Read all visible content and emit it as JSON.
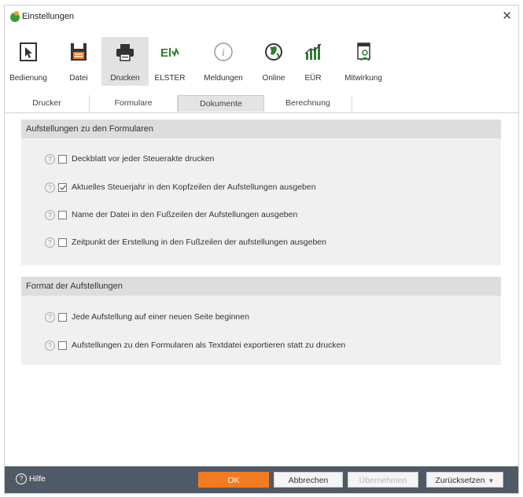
{
  "window": {
    "title": "Einstellungen"
  },
  "toolbar": {
    "items": [
      {
        "label": "Bedienung",
        "icon": "cursor-window-icon"
      },
      {
        "label": "Datei",
        "icon": "floppy-disk-icon"
      },
      {
        "label": "Drucken",
        "icon": "printer-icon",
        "active": true
      },
      {
        "label": "ELSTER",
        "icon": "elster-icon"
      },
      {
        "label": "Meldungen",
        "icon": "info-icon"
      },
      {
        "label": "Online",
        "icon": "globe-icon"
      },
      {
        "label": "EÜR",
        "icon": "bar-chart-icon"
      },
      {
        "label": "Mitwirkung",
        "icon": "person-document-icon"
      }
    ]
  },
  "tabs": [
    "Drucker",
    "Formulare",
    "Dokumente",
    "Berechnung"
  ],
  "active_tab": "Dokumente",
  "sections": [
    {
      "title": "Aufstellungen zu den Formularen",
      "options": [
        {
          "label": "Deckblatt vor jeder Steuerakte drucken",
          "checked": false
        },
        {
          "label": "Aktuelles Steuerjahr in den Kopfzeilen der Aufstellungen ausgeben",
          "checked": true
        },
        {
          "label": "Name der Datei in den Fußzeilen der Aufstellungen ausgeben",
          "checked": false
        },
        {
          "label": "Zeitpunkt der Erstellung in den Fußzeilen der aufstellungen ausgeben",
          "checked": false
        }
      ]
    },
    {
      "title": "Format der Aufstellungen",
      "options": [
        {
          "label": "Jede Aufstellung auf einer neuen Seite beginnen",
          "checked": false
        },
        {
          "label": "Aufstellungen zu den Formularen als Textdatei exportieren statt zu drucken",
          "checked": false
        }
      ]
    }
  ],
  "footer": {
    "help_label": "Hilfe",
    "ok_label": "OK",
    "cancel_label": "Abbrechen",
    "apply_label": "Übernehmen",
    "reset_label": "Zurücksetzen"
  },
  "colors": {
    "accent": "#f47b20",
    "footer_bg": "#505a66"
  }
}
